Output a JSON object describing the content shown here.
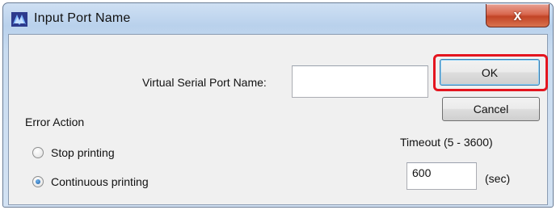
{
  "window": {
    "title": "Input Port Name",
    "close_label": "x"
  },
  "form": {
    "port_name_label": "Virtual Serial Port Name:",
    "port_name_value": "",
    "timeout_label": "Timeout (5 - 3600)",
    "timeout_value": "600",
    "timeout_unit": "(sec)"
  },
  "buttons": {
    "ok_label": "OK",
    "cancel_label": "Cancel"
  },
  "error_action": {
    "label": "Error Action",
    "options": [
      {
        "label": "Stop printing",
        "selected": false
      },
      {
        "label": "Continuous printing",
        "selected": true
      }
    ]
  },
  "annotation": {
    "highlight_color": "#e4151f",
    "target": "OK button"
  },
  "icons": {
    "app": "app-logo-icon",
    "close": "close-icon"
  }
}
